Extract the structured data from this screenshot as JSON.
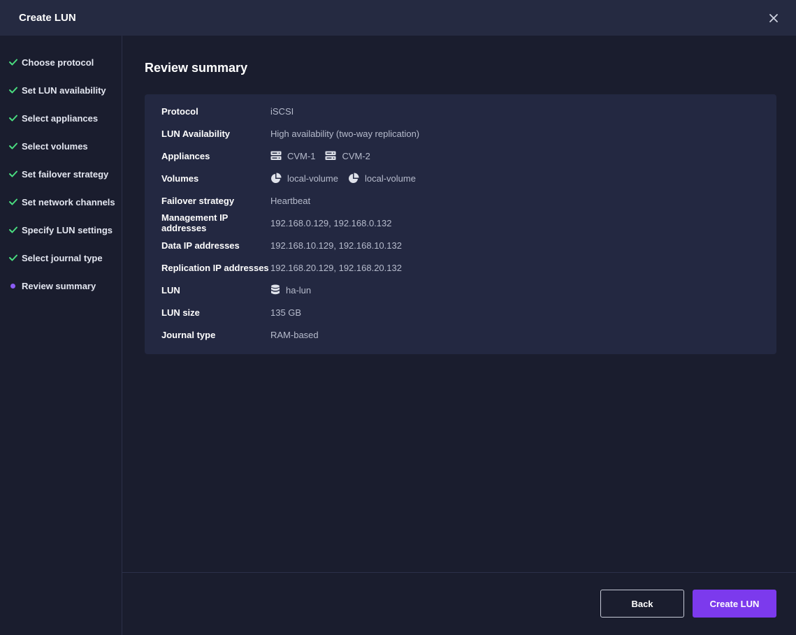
{
  "header": {
    "title": "Create LUN"
  },
  "steps": [
    {
      "label": "Choose protocol",
      "state": "done"
    },
    {
      "label": "Set LUN availability",
      "state": "done"
    },
    {
      "label": "Select appliances",
      "state": "done"
    },
    {
      "label": "Select volumes",
      "state": "done"
    },
    {
      "label": "Set failover strategy",
      "state": "done"
    },
    {
      "label": "Set network channels",
      "state": "done"
    },
    {
      "label": "Specify LUN settings",
      "state": "done"
    },
    {
      "label": "Select journal type",
      "state": "done"
    },
    {
      "label": "Review summary",
      "state": "current"
    }
  ],
  "main": {
    "title": "Review summary",
    "summary": {
      "protocol": {
        "label": "Protocol",
        "value": "iSCSI"
      },
      "availability": {
        "label": "LUN Availability",
        "value": "High availability (two-way replication)"
      },
      "appliances": {
        "label": "Appliances",
        "items": [
          "CVM-1",
          "CVM-2"
        ],
        "icon": "server-icon"
      },
      "volumes": {
        "label": "Volumes",
        "items": [
          "local-volume",
          "local-volume"
        ],
        "icon": "pie-chart-icon"
      },
      "failover": {
        "label": "Failover strategy",
        "value": "Heartbeat"
      },
      "mgmt_ip": {
        "label": "Management IP addresses",
        "value": "192.168.0.129, 192.168.0.132"
      },
      "data_ip": {
        "label": "Data IP addresses",
        "value": "192.168.10.129, 192.168.10.132"
      },
      "repl_ip": {
        "label": "Replication IP addresses",
        "value": "192.168.20.129, 192.168.20.132"
      },
      "lun": {
        "label": "LUN",
        "value": "ha-lun",
        "icon": "database-icon"
      },
      "lun_size": {
        "label": "LUN size",
        "value": "135 GB"
      },
      "journal": {
        "label": "Journal type",
        "value": "RAM-based"
      }
    }
  },
  "footer": {
    "back_label": "Back",
    "create_label": "Create LUN"
  },
  "colors": {
    "check": "#4ade80",
    "accent": "#7c3aed",
    "current_dot": "#8b5cf6"
  }
}
